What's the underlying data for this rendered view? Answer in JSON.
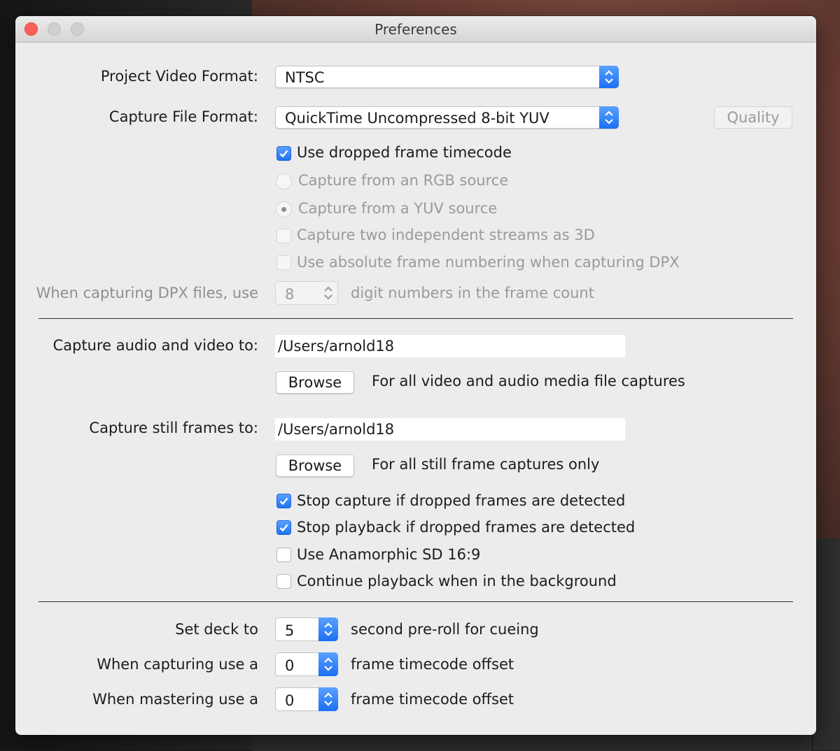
{
  "window": {
    "title": "Preferences"
  },
  "format": {
    "project_video_label": "Project Video Format:",
    "project_video_value": "NTSC",
    "capture_file_label": "Capture File Format:",
    "capture_file_value": "QuickTime Uncompressed 8-bit YUV",
    "quality_button": "Quality"
  },
  "options": {
    "dropped_frame_timecode": {
      "label": "Use dropped frame timecode",
      "checked": true
    },
    "rgb_source": {
      "label": "Capture from an RGB source",
      "selected": false,
      "disabled": true
    },
    "yuv_source": {
      "label": "Capture from a YUV source",
      "selected": true,
      "disabled": true
    },
    "two_streams_3d": {
      "label": "Capture two independent streams as 3D",
      "checked": false,
      "disabled": true
    },
    "absolute_frame_numbering": {
      "label": "Use absolute frame numbering when capturing DPX",
      "checked": false,
      "disabled": true
    }
  },
  "dpx": {
    "prefix": "When capturing DPX files, use",
    "value": "8",
    "suffix": "digit numbers in the frame count"
  },
  "paths": {
    "av_label": "Capture audio and video to:",
    "av_value": "/Users/arnold18",
    "av_browse": "Browse",
    "av_hint": "For all video and audio media file captures",
    "still_label": "Capture still frames to:",
    "still_value": "/Users/arnold18",
    "still_browse": "Browse",
    "still_hint": "For all still frame captures only"
  },
  "playback": {
    "stop_capture_dropped": {
      "label": "Stop capture if dropped frames are detected",
      "checked": true
    },
    "stop_playback_dropped": {
      "label": "Stop playback if dropped frames are detected",
      "checked": true
    },
    "anamorphic": {
      "label": "Use Anamorphic SD 16:9",
      "checked": false
    },
    "continue_background": {
      "label": "Continue playback when in the background",
      "checked": false
    }
  },
  "deck": {
    "preroll_label": "Set deck to",
    "preroll_value": "5",
    "preroll_suffix": "second pre-roll for cueing",
    "capture_offset_label": "When capturing use a",
    "capture_offset_value": "0",
    "capture_offset_suffix": "frame timecode offset",
    "master_offset_label": "When mastering use a",
    "master_offset_value": "0",
    "master_offset_suffix": "frame timecode offset"
  },
  "colors": {
    "accent": "#1f72f2",
    "close": "#fc5f57",
    "window_bg": "#ececec"
  }
}
